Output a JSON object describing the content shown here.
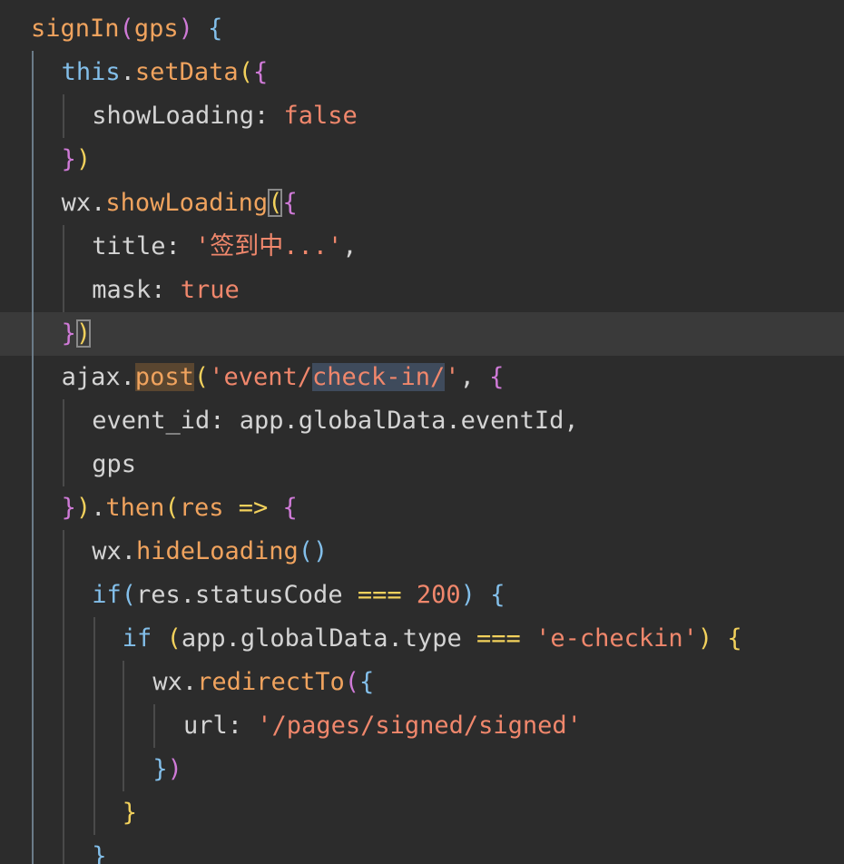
{
  "colors": {
    "background": "#2c2c2c",
    "current_line": "#3a3a3a",
    "plain": "#d4d4d4",
    "function": "#f0a35e",
    "keyword": "#83bfea",
    "string": "#f0876c",
    "bracket_yellow": "#f2d15c",
    "bracket_purple": "#cf7ad7",
    "bracket_blue": "#83bfea"
  },
  "editor": {
    "language": "javascript",
    "current_line_index": 7,
    "lines": [
      {
        "indent": 0,
        "tokens": [
          {
            "t": "signIn",
            "c": "fn"
          },
          {
            "t": "(",
            "c": "paren-p"
          },
          {
            "t": "gps",
            "c": "fn"
          },
          {
            "t": ")",
            "c": "paren-p"
          },
          {
            "t": " ",
            "c": "plain"
          },
          {
            "t": "{",
            "c": "paren-b"
          }
        ]
      },
      {
        "indent": 1,
        "tokens": [
          {
            "t": "this",
            "c": "kw"
          },
          {
            "t": ".",
            "c": "plain"
          },
          {
            "t": "setData",
            "c": "fn"
          },
          {
            "t": "(",
            "c": "paren-y"
          },
          {
            "t": "{",
            "c": "paren-p"
          }
        ]
      },
      {
        "indent": 2,
        "tokens": [
          {
            "t": "showLoading",
            "c": "plain"
          },
          {
            "t": ": ",
            "c": "plain"
          },
          {
            "t": "false",
            "c": "bool"
          }
        ]
      },
      {
        "indent": 1,
        "tokens": [
          {
            "t": "}",
            "c": "paren-p"
          },
          {
            "t": ")",
            "c": "paren-y"
          }
        ]
      },
      {
        "indent": 1,
        "tokens": [
          {
            "t": "wx",
            "c": "plain"
          },
          {
            "t": ".",
            "c": "plain"
          },
          {
            "t": "showLoading",
            "c": "fn"
          },
          {
            "t": "(",
            "c": "paren-y bracket-match"
          },
          {
            "t": "{",
            "c": "paren-p"
          }
        ]
      },
      {
        "indent": 2,
        "tokens": [
          {
            "t": "title",
            "c": "plain"
          },
          {
            "t": ": ",
            "c": "plain"
          },
          {
            "t": "'签到中...'",
            "c": "str"
          },
          {
            "t": ",",
            "c": "plain"
          }
        ]
      },
      {
        "indent": 2,
        "tokens": [
          {
            "t": "mask",
            "c": "plain"
          },
          {
            "t": ": ",
            "c": "plain"
          },
          {
            "t": "true",
            "c": "bool"
          }
        ]
      },
      {
        "indent": 1,
        "tokens": [
          {
            "t": "}",
            "c": "paren-p"
          },
          {
            "t": ")",
            "c": "paren-y bracket-match"
          }
        ]
      },
      {
        "indent": 1,
        "tokens": [
          {
            "t": "ajax",
            "c": "plain"
          },
          {
            "t": ".",
            "c": "plain"
          },
          {
            "t": "post",
            "c": "fn hl-word"
          },
          {
            "t": "(",
            "c": "paren-y"
          },
          {
            "t": "'event/",
            "c": "str"
          },
          {
            "t": "check-in/",
            "c": "str hl-sel"
          },
          {
            "t": "'",
            "c": "str"
          },
          {
            "t": ", ",
            "c": "plain"
          },
          {
            "t": "{",
            "c": "paren-p"
          }
        ]
      },
      {
        "indent": 2,
        "tokens": [
          {
            "t": "event_id",
            "c": "plain"
          },
          {
            "t": ": ",
            "c": "plain"
          },
          {
            "t": "app",
            "c": "plain"
          },
          {
            "t": ".",
            "c": "plain"
          },
          {
            "t": "globalData",
            "c": "plain"
          },
          {
            "t": ".",
            "c": "plain"
          },
          {
            "t": "eventId",
            "c": "plain"
          },
          {
            "t": ",",
            "c": "plain"
          }
        ]
      },
      {
        "indent": 2,
        "tokens": [
          {
            "t": "gps",
            "c": "plain"
          }
        ]
      },
      {
        "indent": 1,
        "tokens": [
          {
            "t": "}",
            "c": "paren-p"
          },
          {
            "t": ")",
            "c": "paren-y"
          },
          {
            "t": ".",
            "c": "plain"
          },
          {
            "t": "then",
            "c": "fn"
          },
          {
            "t": "(",
            "c": "paren-y"
          },
          {
            "t": "res",
            "c": "fn"
          },
          {
            "t": " ",
            "c": "plain"
          },
          {
            "t": "=>",
            "c": "op"
          },
          {
            "t": " ",
            "c": "plain"
          },
          {
            "t": "{",
            "c": "paren-p"
          }
        ]
      },
      {
        "indent": 2,
        "tokens": [
          {
            "t": "wx",
            "c": "plain"
          },
          {
            "t": ".",
            "c": "plain"
          },
          {
            "t": "hideLoading",
            "c": "fn"
          },
          {
            "t": "()",
            "c": "paren-b"
          }
        ]
      },
      {
        "indent": 2,
        "tokens": [
          {
            "t": "if",
            "c": "kw"
          },
          {
            "t": "(",
            "c": "paren-b"
          },
          {
            "t": "res",
            "c": "plain"
          },
          {
            "t": ".",
            "c": "plain"
          },
          {
            "t": "statusCode",
            "c": "plain"
          },
          {
            "t": " ",
            "c": "plain"
          },
          {
            "t": "===",
            "c": "op"
          },
          {
            "t": " ",
            "c": "plain"
          },
          {
            "t": "200",
            "c": "num"
          },
          {
            "t": ")",
            "c": "paren-b"
          },
          {
            "t": " ",
            "c": "plain"
          },
          {
            "t": "{",
            "c": "paren-b"
          }
        ]
      },
      {
        "indent": 3,
        "tokens": [
          {
            "t": "if",
            "c": "kw"
          },
          {
            "t": " ",
            "c": "plain"
          },
          {
            "t": "(",
            "c": "paren-y"
          },
          {
            "t": "app",
            "c": "plain"
          },
          {
            "t": ".",
            "c": "plain"
          },
          {
            "t": "globalData",
            "c": "plain"
          },
          {
            "t": ".",
            "c": "plain"
          },
          {
            "t": "type",
            "c": "plain"
          },
          {
            "t": " ",
            "c": "plain"
          },
          {
            "t": "===",
            "c": "op"
          },
          {
            "t": " ",
            "c": "plain"
          },
          {
            "t": "'e-checkin'",
            "c": "str"
          },
          {
            "t": ")",
            "c": "paren-y"
          },
          {
            "t": " ",
            "c": "plain"
          },
          {
            "t": "{",
            "c": "paren-y"
          }
        ]
      },
      {
        "indent": 4,
        "tokens": [
          {
            "t": "wx",
            "c": "plain"
          },
          {
            "t": ".",
            "c": "plain"
          },
          {
            "t": "redirectTo",
            "c": "fn"
          },
          {
            "t": "(",
            "c": "paren-p"
          },
          {
            "t": "{",
            "c": "paren-b"
          }
        ]
      },
      {
        "indent": 5,
        "tokens": [
          {
            "t": "url",
            "c": "plain"
          },
          {
            "t": ": ",
            "c": "plain"
          },
          {
            "t": "'/pages/signed/signed'",
            "c": "str"
          }
        ]
      },
      {
        "indent": 4,
        "tokens": [
          {
            "t": "}",
            "c": "paren-b"
          },
          {
            "t": ")",
            "c": "paren-p"
          }
        ]
      },
      {
        "indent": 3,
        "tokens": [
          {
            "t": "}",
            "c": "paren-y"
          }
        ]
      },
      {
        "indent": 2,
        "tokens": [
          {
            "t": "}",
            "c": "paren-b"
          }
        ]
      }
    ]
  }
}
